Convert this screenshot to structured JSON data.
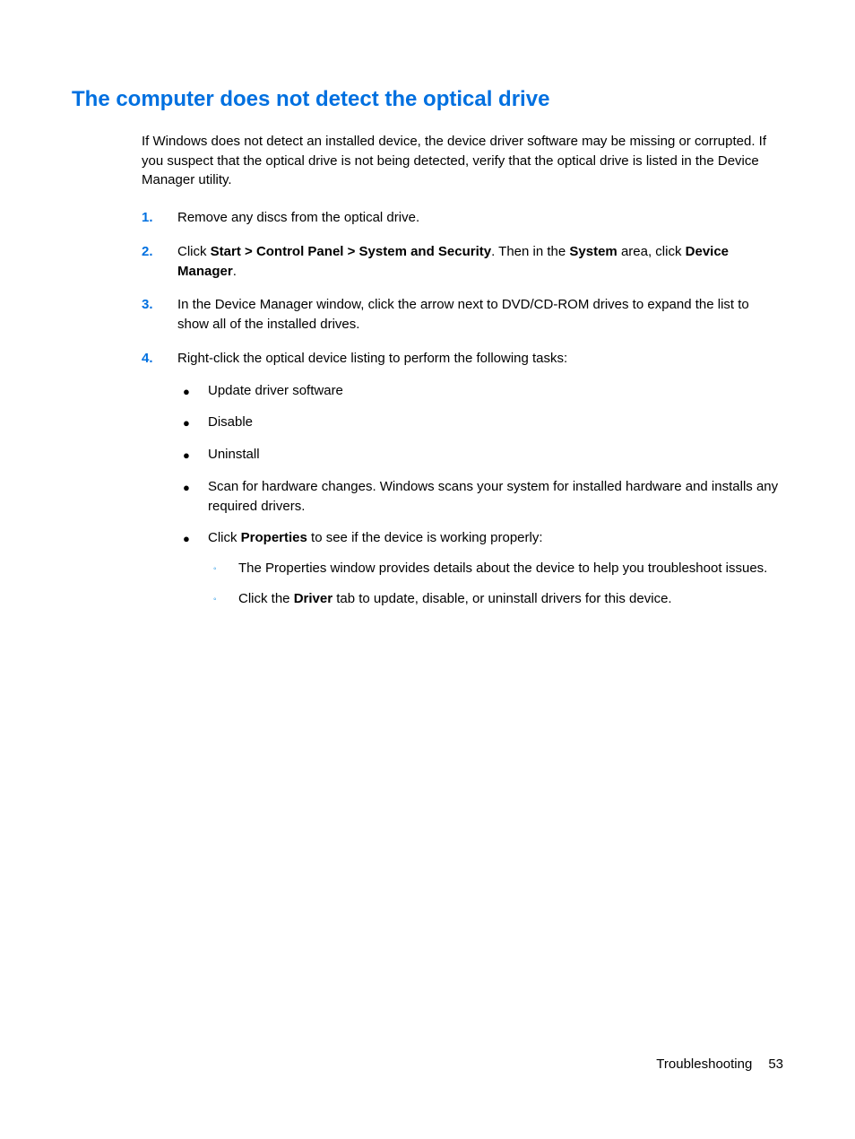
{
  "heading": "The computer does not detect the optical drive",
  "intro": "If Windows does not detect an installed device, the device driver software may be missing or corrupted. If you suspect that the optical drive is not being detected, verify that the optical drive is listed in the Device Manager utility.",
  "steps": {
    "s1": {
      "num": "1.",
      "text": "Remove any discs from the optical drive."
    },
    "s2": {
      "num": "2.",
      "pre": "Click ",
      "b1": "Start > Control Panel > System and Security",
      "mid1": ". Then in the ",
      "b2": "System",
      "mid2": " area, click ",
      "b3": "Device Manager",
      "post": "."
    },
    "s3": {
      "num": "3.",
      "text": "In the Device Manager window, click the arrow next to DVD/CD-ROM drives to expand the list to show all of the installed drives."
    },
    "s4": {
      "num": "4.",
      "text": "Right-click the optical device listing to perform the following tasks:",
      "bullets": {
        "b1": "Update driver software",
        "b2": "Disable",
        "b3": "Uninstall",
        "b4": "Scan for hardware changes. Windows scans your system for installed hardware and installs any required drivers.",
        "b5": {
          "pre": "Click ",
          "bold": "Properties",
          "post": " to see if the device is working properly:",
          "subs": {
            "s1": "The Properties window provides details about the device to help you troubleshoot issues.",
            "s2": {
              "pre": "Click the ",
              "bold": "Driver",
              "post": " tab to update, disable, or uninstall drivers for this device."
            }
          }
        }
      }
    }
  },
  "footer": {
    "section": "Troubleshooting",
    "page": "53"
  }
}
